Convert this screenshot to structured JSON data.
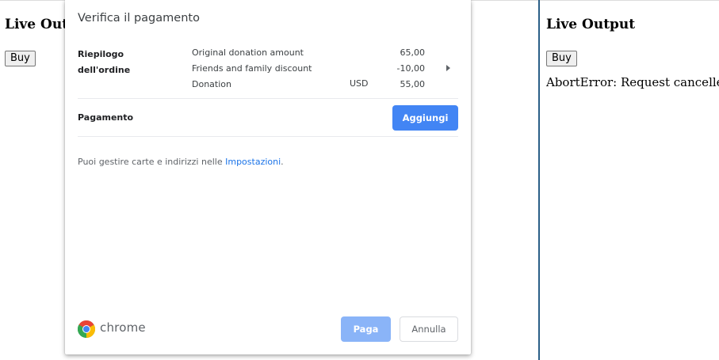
{
  "background_page": {
    "title": "Live Output",
    "buy_label": "Buy"
  },
  "output_pane": {
    "title": "Live Output",
    "buy_label": "Buy",
    "message": "AbortError: Request cancelled"
  },
  "dialog": {
    "title": "Verifica il pagamento",
    "order_summary_label": "Riepilogo dell'ordine",
    "items": [
      {
        "label": "Original donation amount",
        "amount": "65,00"
      },
      {
        "label": "Friends and family discount",
        "amount": "-10,00"
      }
    ],
    "total": {
      "label": "Donation",
      "currency": "USD",
      "amount": "55,00"
    },
    "payment_label": "Pagamento",
    "add_button": "Aggiungi",
    "info_text": "Puoi gestire carte e indirizzi nelle ",
    "info_link": "Impostazioni",
    "info_suffix": ".",
    "brand": "chrome",
    "pay_button": "Paga",
    "cancel_button": "Annulla"
  },
  "colors": {
    "primary_button": "#4285f4",
    "disabled_button": "#8ab4f8",
    "link": "#1a73e8",
    "divider": "#2b5f87"
  }
}
